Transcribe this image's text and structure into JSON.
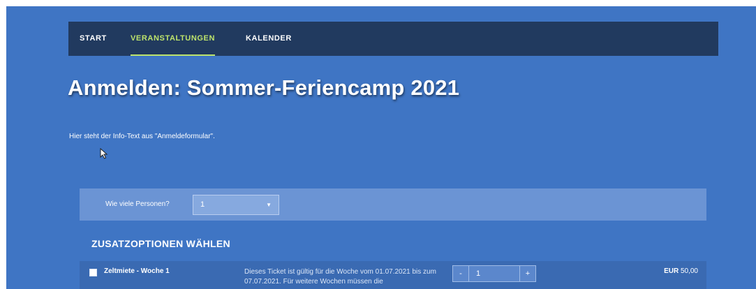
{
  "nav": {
    "items": [
      {
        "label": "START",
        "active": false
      },
      {
        "label": "VERANSTALTUNGEN",
        "active": true
      },
      {
        "label": "KALENDER",
        "active": false
      }
    ]
  },
  "page": {
    "title": "Anmelden: Sommer-Feriencamp 2021",
    "info_text": "Hier steht der Info-Text aus \"Anmeldeformular\"."
  },
  "persons": {
    "label": "Wie viele Personen?",
    "selected": "1"
  },
  "options_section": {
    "heading": "ZUSATZOPTIONEN WÄHLEN",
    "items": [
      {
        "name": "Zeltmiete - Woche 1",
        "description": "Dieses Ticket ist gültig für die Woche vom 01.07.2021 bis zum 07.07.2021. Für weitere Wochen müssen die",
        "quantity": "1",
        "minus": "-",
        "plus": "+",
        "currency": "EUR",
        "price": "50,00"
      }
    ]
  },
  "colors": {
    "background": "#3f75c4",
    "nav_bg": "#213a5f",
    "accent": "#bde36b"
  },
  "icons": [
    "chevron-down-icon",
    "mouse-cursor-icon",
    "checkbox"
  ]
}
